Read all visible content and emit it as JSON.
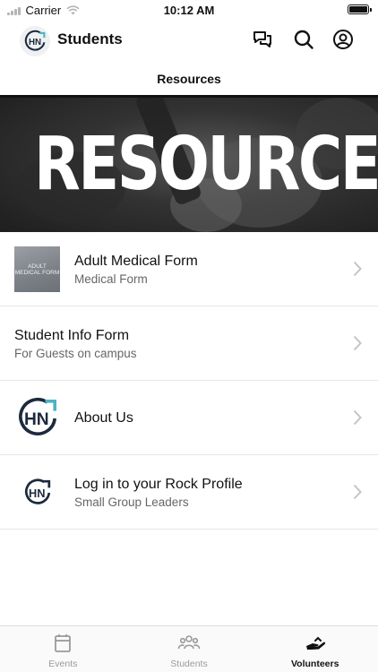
{
  "status_bar": {
    "carrier": "Carrier",
    "time": "10:12 AM"
  },
  "header": {
    "title": "Students"
  },
  "page": {
    "section_title": "Resources"
  },
  "banner": {
    "text": "RESOURCES"
  },
  "resources": [
    {
      "title": "Adult Medical Form",
      "subtitle": "Medical Form",
      "thumb_text": "ADULT MEDICAL FORM",
      "thumb": "photo"
    },
    {
      "title": "Student Info Form",
      "subtitle": "For Guests on campus"
    },
    {
      "title": "About Us",
      "thumb": "hn-logo-large"
    },
    {
      "title": "Log in to your Rock Profile",
      "subtitle": "Small Group Leaders",
      "thumb": "hn-logo-small"
    }
  ],
  "tabs": [
    {
      "label": "Events",
      "icon": "calendar-icon",
      "active": false
    },
    {
      "label": "Students",
      "icon": "group-icon",
      "active": false
    },
    {
      "label": "Volunteers",
      "icon": "helping-hand-icon",
      "active": true
    }
  ],
  "colors": {
    "accent": "#4db3c4",
    "logo_navy": "#1d2a3d",
    "text": "#111111",
    "subtext": "#666666"
  }
}
